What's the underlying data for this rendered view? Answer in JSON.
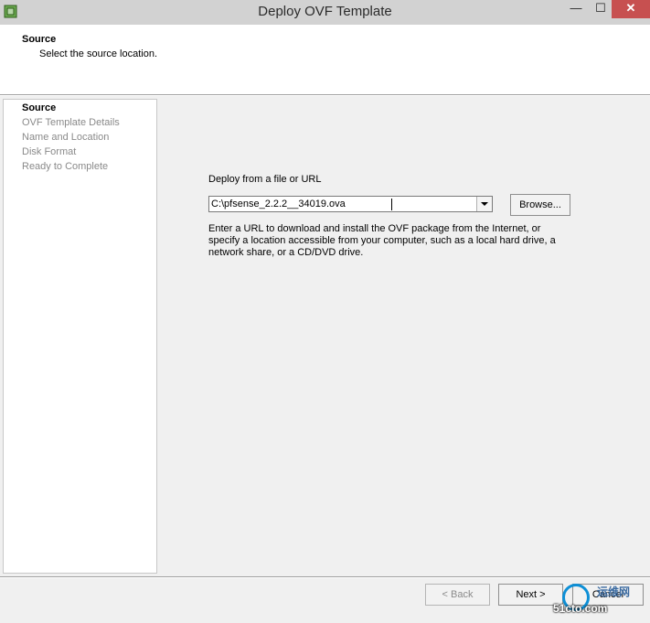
{
  "window": {
    "title": "Deploy OVF Template",
    "minimize": "—",
    "maximize": "☐",
    "close": "✕"
  },
  "header": {
    "title": "Source",
    "subtitle": "Select the source location."
  },
  "steps": [
    {
      "label": "Source",
      "active": true
    },
    {
      "label": "OVF Template Details",
      "active": false
    },
    {
      "label": "Name and Location",
      "active": false
    },
    {
      "label": "Disk Format",
      "active": false
    },
    {
      "label": "Ready to Complete",
      "active": false
    }
  ],
  "main": {
    "deploy_label": "Deploy from a file or URL",
    "source_value": "C:\\pfsense_2.2.2__34019.ova",
    "browse_label": "Browse...",
    "help_text": "Enter a URL to download and install the OVF package from the Internet, or specify a location accessible from your computer, such as a local hard drive, a network share, or a CD/DVD drive."
  },
  "footer": {
    "back_label": "< Back",
    "next_label": "Next >",
    "cancel_label": "Cancel"
  },
  "watermark": {
    "top": "运维网",
    "bottom": "51cto.com"
  },
  "colors": {
    "titlebar": "#d2d2d2",
    "close": "#c75050",
    "panel": "#f0f0f0",
    "disabled_text": "#8a8a8a"
  }
}
